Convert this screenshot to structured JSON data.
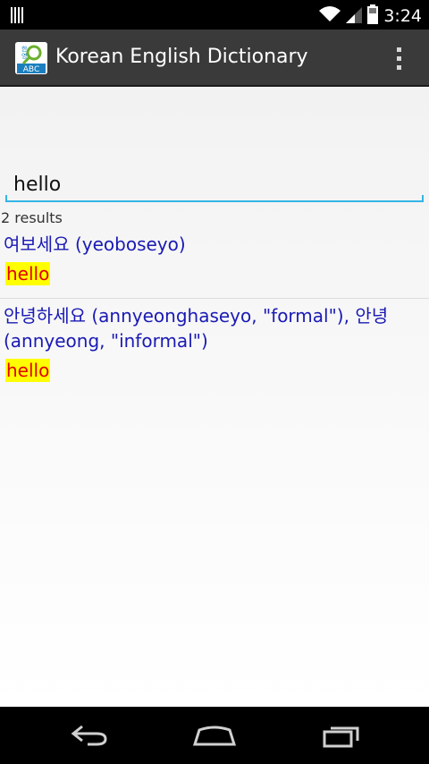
{
  "status_bar": {
    "time": "3:24",
    "icons": [
      "barcode-icon",
      "wifi-icon",
      "signal-icon",
      "battery-icon"
    ]
  },
  "action_bar": {
    "title": "Korean English Dictionary",
    "app_icon": "dictionary-app-icon",
    "menu_icon": "overflow-menu-icon",
    "icon_text": {
      "top": "한\n영",
      "bottom": "ABC"
    }
  },
  "search": {
    "value": "hello"
  },
  "results": {
    "count_label": "2 results",
    "items": [
      {
        "korean": "여보세요 (yeoboseyo)",
        "english": "hello"
      },
      {
        "korean": "안녕하세요 (annyeonghaseyo, \"formal\"), 안녕 (annyeong, \"informal\")",
        "english": "hello"
      }
    ]
  },
  "navigation": {
    "back_icon": "back-icon",
    "home_icon": "home-icon",
    "recents_icon": "recent-apps-icon"
  },
  "colors": {
    "korean_text": "#1a1ab5",
    "english_text": "#e00000",
    "highlight": "#ffff00",
    "accent": "#33b5e5"
  }
}
